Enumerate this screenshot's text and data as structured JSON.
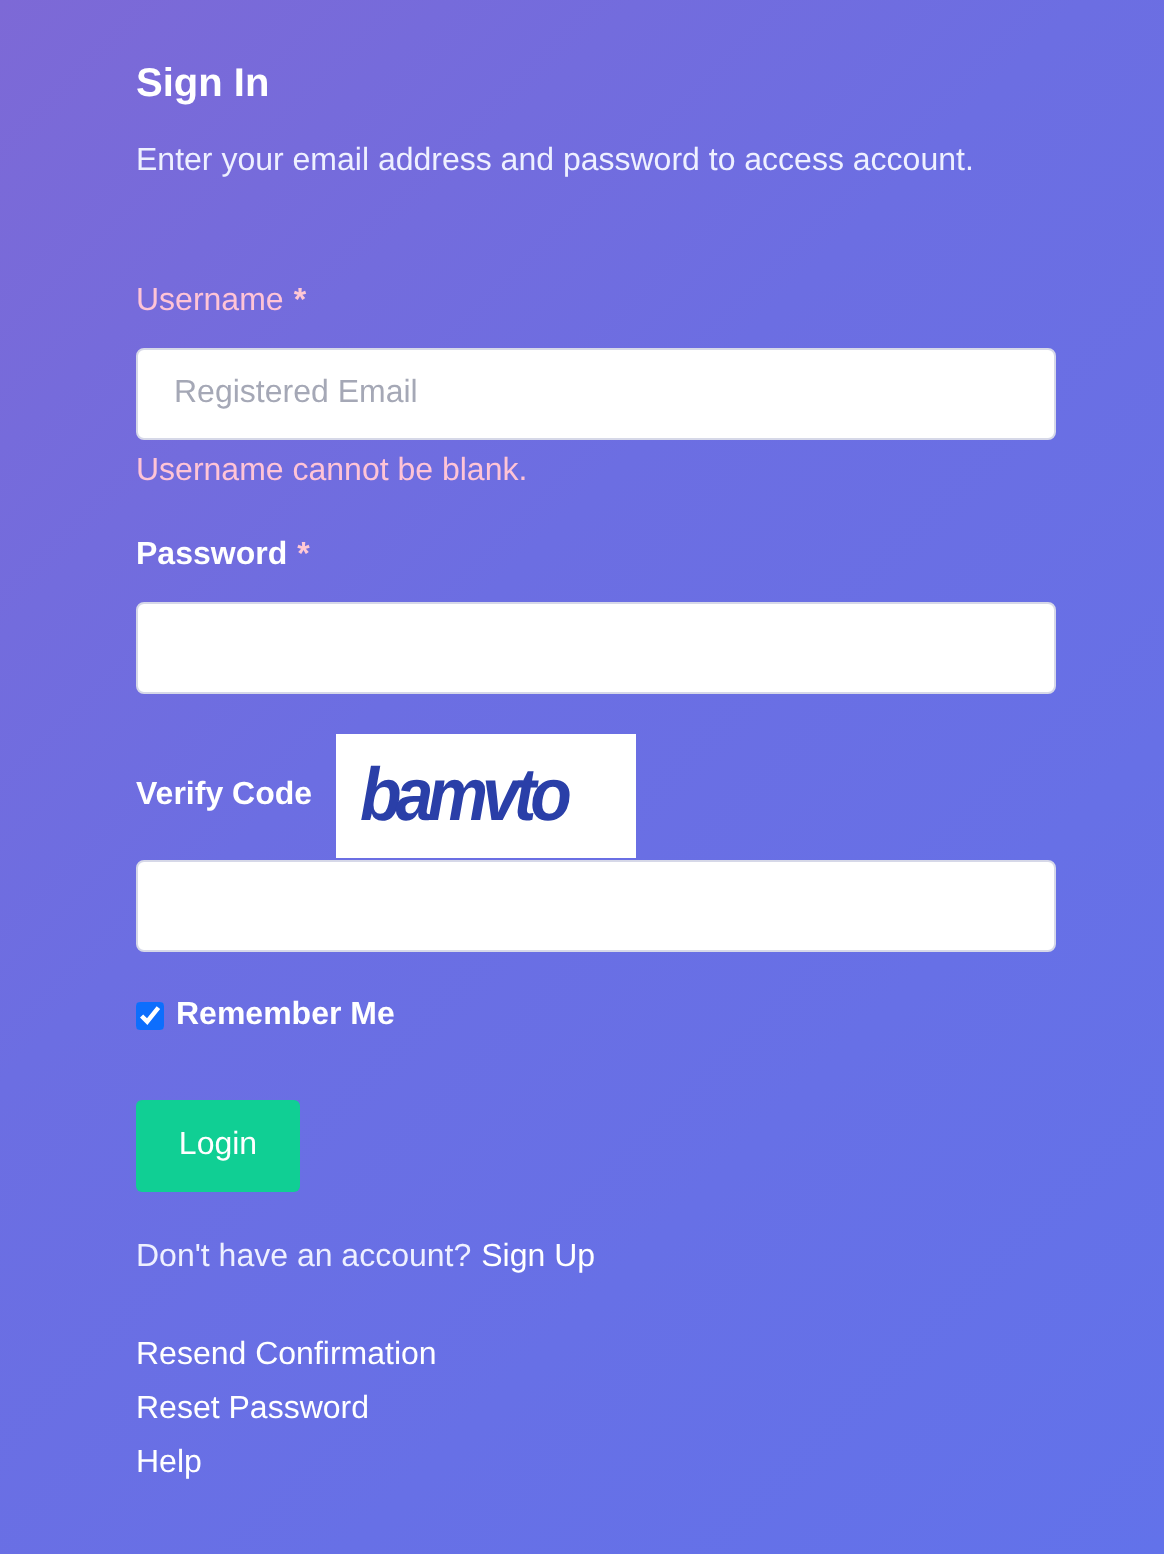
{
  "title": "Sign In",
  "subtitle": "Enter your email address and password to access account.",
  "fields": [
    {
      "label": "Username",
      "marker": "*",
      "invalid": true,
      "placeholder": "Registered Email",
      "error": "Username cannot be blank."
    },
    {
      "label": "Password",
      "marker": "*",
      "invalid": false
    }
  ],
  "captcha": {
    "label": "Verify Code",
    "code": "bamvto"
  },
  "remember": {
    "label": "Remember Me",
    "checked": true
  },
  "login_button": "Login",
  "signup": {
    "text": "Don't have an account?",
    "link": "Sign Up"
  },
  "links": [
    "Resend Confirmation",
    "Reset Password",
    "Help"
  ]
}
